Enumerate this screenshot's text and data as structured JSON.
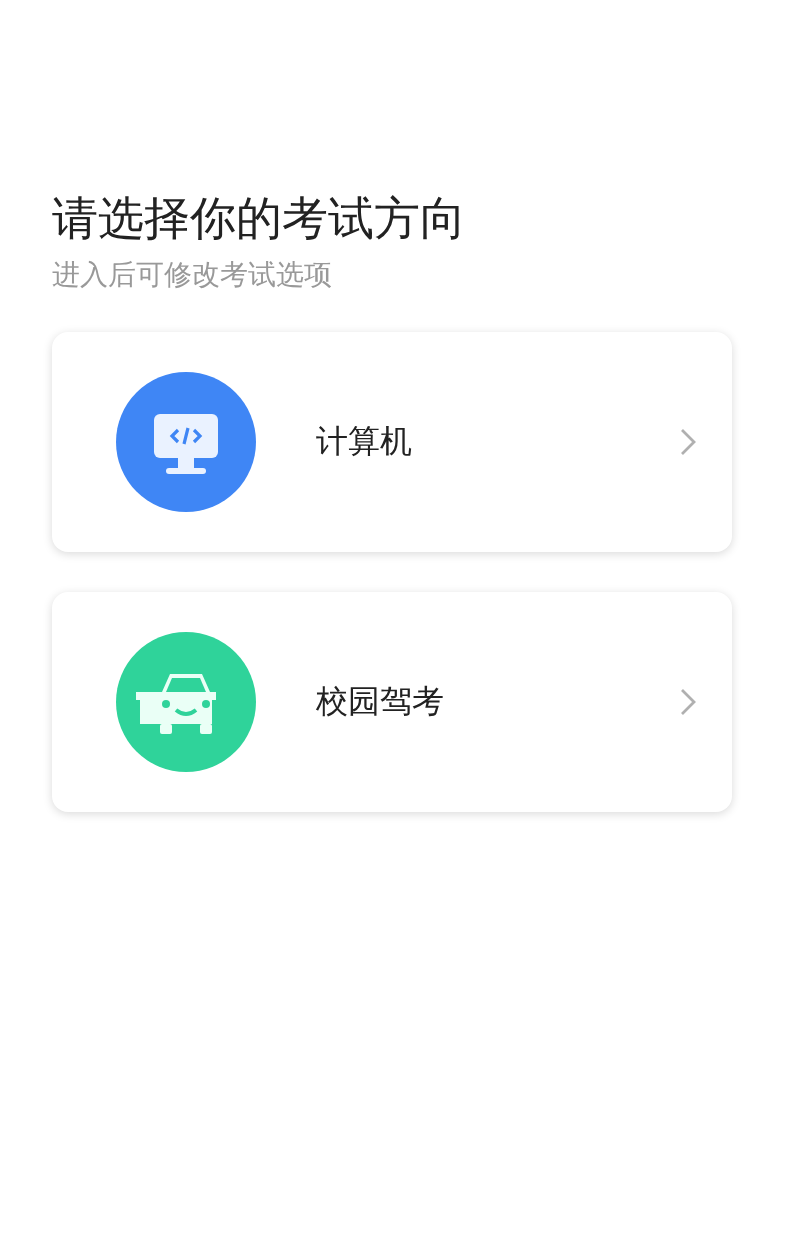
{
  "title": "请选择你的考试方向",
  "subtitle": "进入后可修改考试选项",
  "options": [
    {
      "kind": "computer",
      "label": "计算机"
    },
    {
      "kind": "car",
      "label": "校园驾考"
    }
  ]
}
